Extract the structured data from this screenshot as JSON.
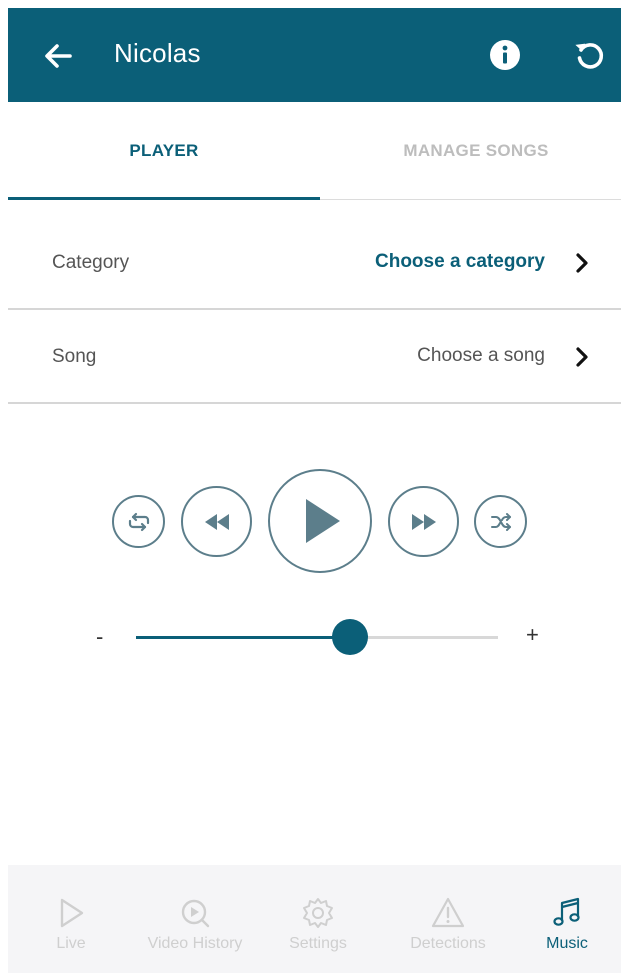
{
  "header": {
    "title": "Nicolas"
  },
  "tabs": [
    {
      "label": "PLAYER",
      "active": true
    },
    {
      "label": "MANAGE SONGS",
      "active": false
    }
  ],
  "fields": {
    "category": {
      "label": "Category",
      "value": "Choose a category"
    },
    "song": {
      "label": "Song",
      "value": "Choose a song"
    }
  },
  "volume": {
    "minus": "-",
    "plus": "+",
    "level": 0.59
  },
  "bottom_nav": [
    {
      "label": "Live",
      "icon": "play-outline-icon",
      "active": false
    },
    {
      "label": "Video History",
      "icon": "video-history-icon",
      "active": false
    },
    {
      "label": "Settings",
      "icon": "gear-icon",
      "active": false
    },
    {
      "label": "Detections",
      "icon": "warning-icon",
      "active": false
    },
    {
      "label": "Music",
      "icon": "music-note-icon",
      "active": true
    }
  ],
  "colors": {
    "primary": "#0b5f78",
    "control_outline": "#5c7e8b",
    "inactive": "#cfcfcf"
  }
}
